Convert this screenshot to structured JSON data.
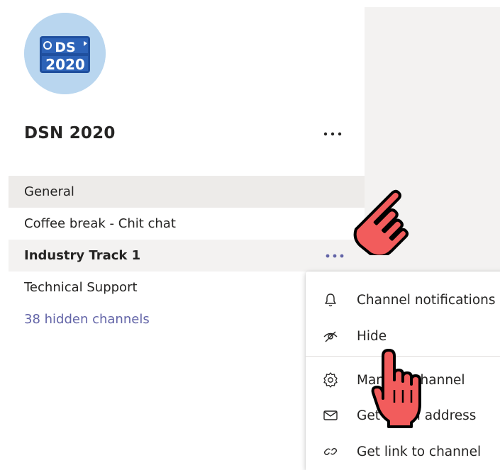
{
  "team": {
    "name": "DSN 2020",
    "avatar_text_top": "DS",
    "avatar_text_bottom": "2020"
  },
  "channels": [
    {
      "label": "General"
    },
    {
      "label": "Coffee break - Chit chat"
    },
    {
      "label": "Industry Track 1"
    },
    {
      "label": "Technical Support"
    },
    {
      "label": "38 hidden channels"
    }
  ],
  "context_menu": {
    "items": [
      {
        "label": "Channel notifications",
        "icon": "bell-icon"
      },
      {
        "label": "Hide",
        "icon": "eye-off-icon"
      },
      {
        "label": "Manage channel",
        "icon": "gear-icon"
      },
      {
        "label": "Get email address",
        "icon": "envelope-icon"
      },
      {
        "label": "Get link to channel",
        "icon": "link-icon"
      }
    ]
  },
  "colors": {
    "accent": "#6264a7",
    "selected_bg": "#edebe9",
    "hover_bg": "#f3f2f1",
    "pointer_fill": "#f25c5c"
  }
}
